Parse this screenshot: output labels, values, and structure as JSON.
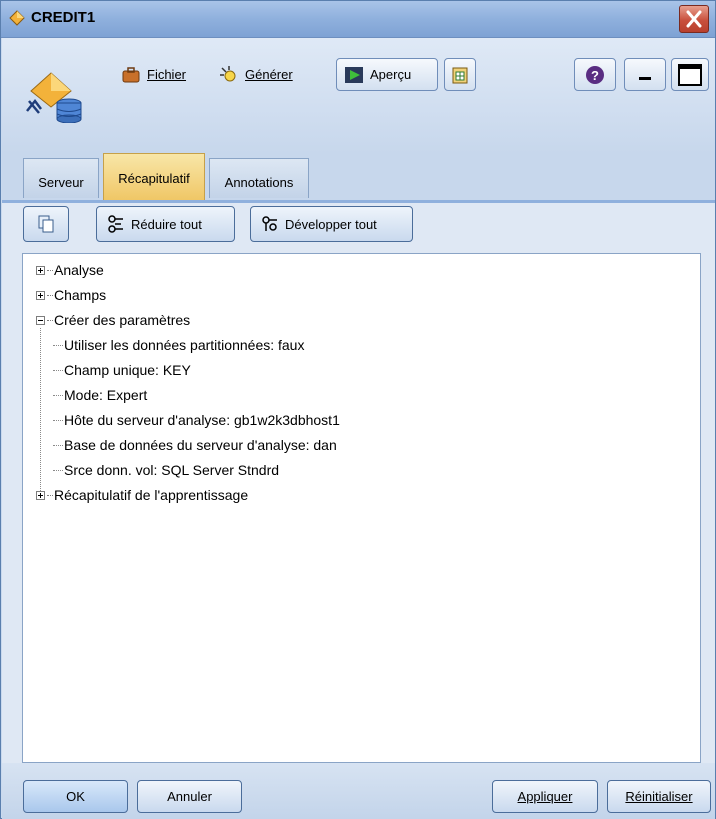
{
  "window": {
    "title": "CREDIT1",
    "close_label": "X"
  },
  "toolbar": {
    "file_label": "Fichier",
    "generate_label": "Générer",
    "preview_label": "Aperçu"
  },
  "tabs": [
    {
      "label": "Serveur",
      "active": false
    },
    {
      "label": "Récapitulatif",
      "active": true
    },
    {
      "label": "Annotations",
      "active": false
    }
  ],
  "panel": {
    "collapse_all_label": "Réduire tout",
    "expand_all_label": "Développer tout"
  },
  "tree": {
    "nodes": [
      {
        "label": "Analyse",
        "expanded": false
      },
      {
        "label": "Champs",
        "expanded": false
      },
      {
        "label": "Créer des paramètres",
        "expanded": true,
        "children": [
          "Utiliser les données partitionnées: faux",
          "Champ unique: KEY",
          "Mode: Expert",
          "Hôte du serveur d'analyse: gb1w2k3dbhost1",
          "Base de données du serveur d'analyse: dan",
          "Srce donn. vol: SQL Server Stndrd"
        ]
      },
      {
        "label": "Récapitulatif de l'apprentissage",
        "expanded": false
      }
    ]
  },
  "footer": {
    "ok_label": "OK",
    "cancel_label": "Annuler",
    "apply_label": "Appliquer",
    "reset_label": "Réinitialiser"
  },
  "colors": {
    "titlebar": "#8fb0dd",
    "active_tab": "#f0c766",
    "close_button": "#c9503d",
    "help_icon": "#5a2d82"
  }
}
